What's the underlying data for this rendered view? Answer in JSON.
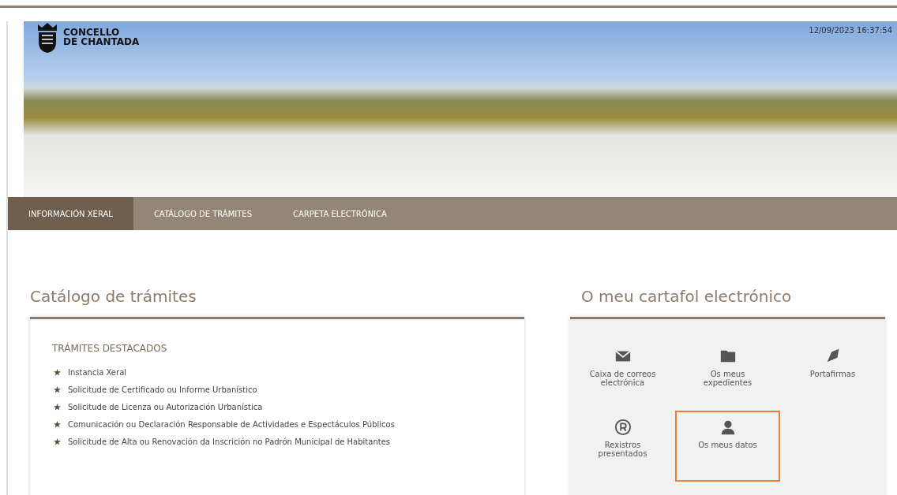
{
  "header": {
    "logo_lines": [
      "CONCELLO",
      "DE CHANTADA"
    ],
    "datetime": "12/09/2023 16:37:54"
  },
  "nav": [
    {
      "label": "INFORMACIÓN XERAL",
      "selected": true
    },
    {
      "label": "CATÁLOGO DE TRÁMITES",
      "selected": false
    },
    {
      "label": "CARPETA ELECTRÓNICA",
      "selected": false
    }
  ],
  "catalog": {
    "title": "Catálogo de trámites",
    "section": "TRÁMITES DESTACADOS",
    "items": [
      "Instancia Xeral",
      "Solicitude de Certificado ou Informe Urbanístico",
      "Solicitude de Licenza ou Autorización Urbanística",
      "Comunicación ou Declaración Responsable de Actividades e Espectáculos Públicos",
      "Solicitude de Alta ou Renovación da Inscrición no Padrón Municipal de Habitantes"
    ]
  },
  "folder": {
    "title": "O meu cartafol electrónico",
    "items": [
      {
        "kind": "mail",
        "label": "Caixa de correos electrónica",
        "selected": false
      },
      {
        "kind": "folder",
        "label": "Os meus expedientes",
        "selected": false
      },
      {
        "kind": "pen",
        "label": "Portafirmas",
        "selected": false
      },
      {
        "kind": "registered",
        "label": "Rexistros presentados",
        "selected": false
      },
      {
        "kind": "user",
        "label": "Os meus datos",
        "selected": true
      }
    ]
  }
}
